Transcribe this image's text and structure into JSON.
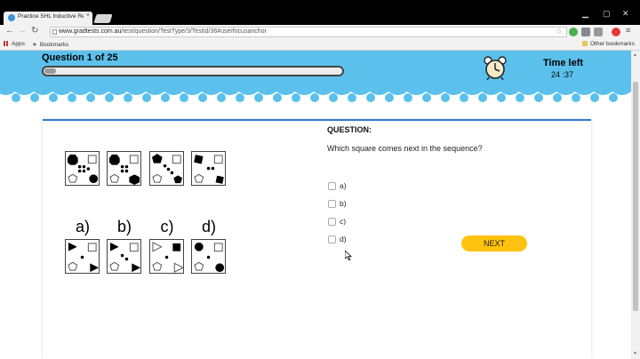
{
  "browser": {
    "tab_title": "Practice SHL Inductive Re",
    "tab_close": "×",
    "url_host": "www.gradtests.com.au",
    "url_path": "/test/question/TestType/3/TestId/36#userfocusanchor",
    "bookmarks": [
      {
        "label": "Apps",
        "icon": "apps-grid-icon"
      },
      {
        "label": "Bookmarks",
        "icon": "star-icon"
      }
    ],
    "other_bookmarks": "Other bookmarks"
  },
  "header": {
    "question_count": "Question 1 of 25",
    "progress": 0.04,
    "time_label": "Time left",
    "time_value": "24 :37",
    "colors": {
      "banner": "#5bc1ec",
      "accent": "#2f7dcb",
      "button": "#ffc20e"
    }
  },
  "puzzle": {
    "sequence_count": 4,
    "option_letters": [
      "a)",
      "b)",
      "c)",
      "d)"
    ]
  },
  "question": {
    "heading": "QUESTION:",
    "text": "Which square comes next in the sequence?",
    "answers": [
      "a)",
      "b)",
      "c)",
      "d)"
    ],
    "selected": null,
    "next_label": "NEXT"
  }
}
